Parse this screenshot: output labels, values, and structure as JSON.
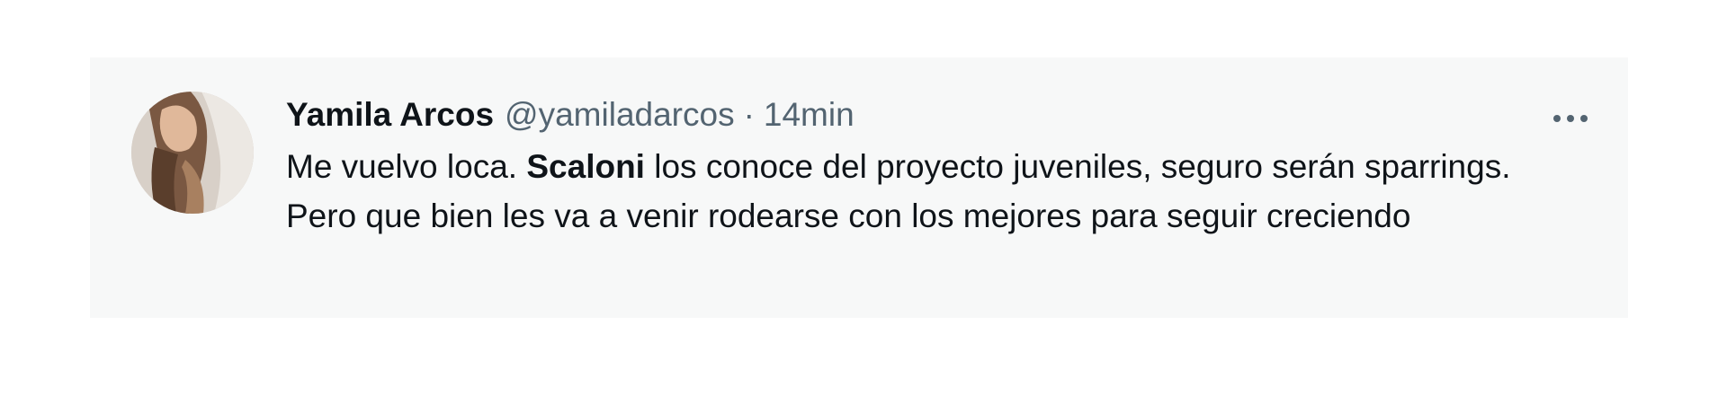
{
  "tweet": {
    "author": {
      "display_name": "Yamila Arcos",
      "handle": "@yamiladarcos",
      "avatar": "profile-photo"
    },
    "separator": "·",
    "timestamp": "14min",
    "text": {
      "before": "Me vuelvo loca. ",
      "bold": "Scaloni",
      "after": " los conoce del proyecto juveniles, seguro serán sparrings. Pero que bien les va a venir rodearse con los mejores para seguir creciendo"
    },
    "more_icon": "more-horizontal-icon"
  },
  "colors": {
    "card_background": "#f7f8f8",
    "primary_text": "#0f1419",
    "secondary_text": "#536471"
  }
}
